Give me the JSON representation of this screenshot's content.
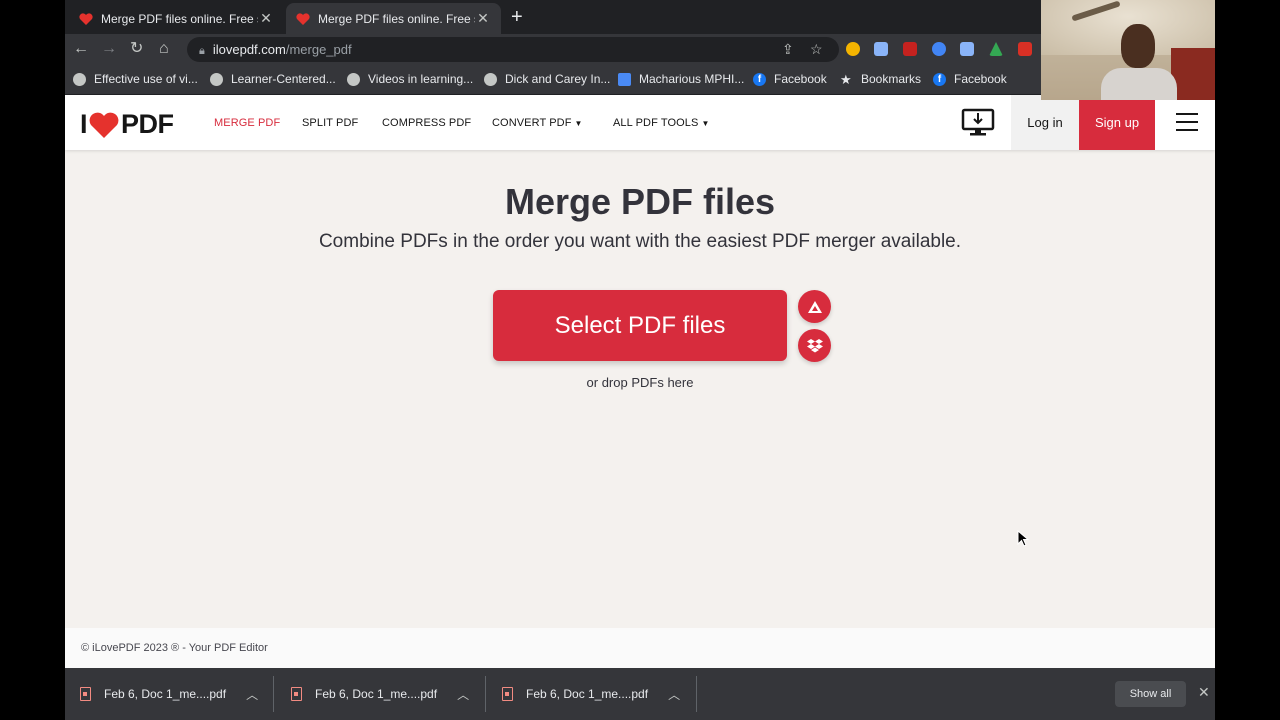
{
  "browser": {
    "tabs": [
      {
        "title": "Merge PDF files online. Free se"
      },
      {
        "title": "Merge PDF files online. Free se"
      }
    ],
    "new_tab_icon": "plus-icon",
    "url": {
      "domain": "ilovepdf.com",
      "path": "/merge_pdf"
    },
    "bookmarks": [
      {
        "label": "Effective use of vi...",
        "icon": "globe-icon"
      },
      {
        "label": "Learner-Centered...",
        "icon": "globe-icon"
      },
      {
        "label": "Videos in learning...",
        "icon": "globe-icon"
      },
      {
        "label": "Dick and Carey In...",
        "icon": "globe-icon"
      },
      {
        "label": "Macharious MPHI...",
        "icon": "doc-icon"
      },
      {
        "label": "Facebook",
        "icon": "facebook-icon"
      },
      {
        "label": "Bookmarks",
        "icon": "star-icon"
      },
      {
        "label": "Facebook",
        "icon": "facebook-icon"
      }
    ]
  },
  "site": {
    "logo": {
      "left": "I",
      "right": "PDF"
    },
    "nav": {
      "merge": "MERGE PDF",
      "split": "SPLIT PDF",
      "compress": "COMPRESS PDF",
      "convert": "CONVERT PDF",
      "all_tools": "ALL PDF TOOLS"
    },
    "login": "Log in",
    "signup": "Sign up",
    "accent_color": "#d72c3d"
  },
  "main": {
    "title": "Merge PDF files",
    "subtitle": "Combine PDFs in the order you want with the easiest PDF merger available.",
    "select_button": "Select PDF files",
    "drop_text": "or drop PDFs here"
  },
  "footer": {
    "text": "© iLovePDF 2023 ® - Your PDF Editor"
  },
  "downloads": {
    "items": [
      {
        "name": "Feb 6, Doc 1_me....pdf"
      },
      {
        "name": "Feb 6, Doc 1_me....pdf"
      },
      {
        "name": "Feb 6, Doc 1_me....pdf"
      }
    ],
    "show_all": "Show all"
  }
}
